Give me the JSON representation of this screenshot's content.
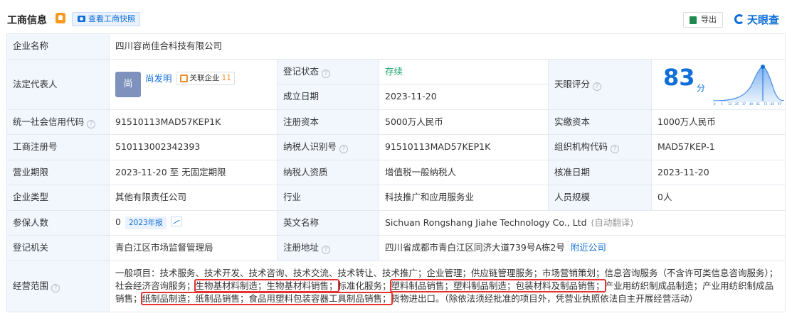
{
  "header": {
    "title": "工商信息",
    "snapshot_btn": "查看工商快照",
    "export_btn": "导出",
    "logo": "天眼查",
    "accent": "#0f6ed8"
  },
  "rows": {
    "company_name_label": "企业名称",
    "company_name": "四川容尚佳合科技有限公司",
    "legal_rep_label": "法定代表人",
    "legal_rep_avatar": "尚",
    "legal_rep_name": "尚发明",
    "related_label": "关联企业",
    "related_count": "11",
    "reg_status_label": "登记状态",
    "reg_status": "存续",
    "found_date_label": "成立日期",
    "found_date": "2023-11-20",
    "score_label": "天眼评分",
    "score": "83",
    "score_unit": "分",
    "credit_code_label": "统一社会信用代码",
    "credit_code": "91510113MAD57KEP1K",
    "reg_capital_label": "注册资本",
    "reg_capital": "5000万人民币",
    "paid_capital_label": "实缴资本",
    "paid_capital": "1000万人民币",
    "reg_no_label": "工商注册号",
    "reg_no": "510113002342393",
    "taxpayer_id_label": "纳税人识别号",
    "taxpayer_id": "91510113MAD57KEP1K",
    "org_code_label": "组织机构代码",
    "org_code": "MAD57KEP-1",
    "term_label": "营业期限",
    "term": "2023-11-20 至 无固定期限",
    "taxpayer_qual_label": "纳税人资质",
    "taxpayer_qual": "增值税一般纳税人",
    "approve_date_label": "核准日期",
    "approve_date": "2023-11-20",
    "type_label": "企业类型",
    "type": "其他有限责任公司",
    "industry_label": "行业",
    "industry": "科技推广和应用服务业",
    "staff_label": "人员规模",
    "staff": "0人",
    "insured_label": "参保人数",
    "insured": "0",
    "report_badge": "2023年报",
    "english_name_label": "英文名称",
    "english_name": "Sichuan Rongshang Jiahe Technology Co., Ltd",
    "auto_translate": "(自动翻译)",
    "authority_label": "登记机关",
    "authority": "青白江区市场监督管理局",
    "address_label": "注册地址",
    "address": "四川省成都市青白江区同济大道739号A栋2号",
    "nearby": "附近公司",
    "scope_label": "经营范围",
    "scope_1": "一般项目：技术服务、技术开发、技术咨询、技术交流、技术转让、技术推广；企业管理；供应链管理服务；市场营销策划；信息咨询服务（不含许可类信息咨询服务）；社会经济咨询服务；",
    "scope_hl1": "生物基材料制造；生物基材料销售；",
    "scope_2": "标准化服务；",
    "scope_hl2": "塑料制品销售；塑料制品制造；包装材料及制品销售；",
    "scope_3": "产业用纺织制成品制造；产业用纺织制成品销售；",
    "scope_hl3": "纸制品制造；纸制品销售；食品用塑料包装容器工具制品销售；",
    "scope_4": "货物进出口。（除依法须经批准的项目外，凭营业执照依法自主开展经营活动）"
  }
}
